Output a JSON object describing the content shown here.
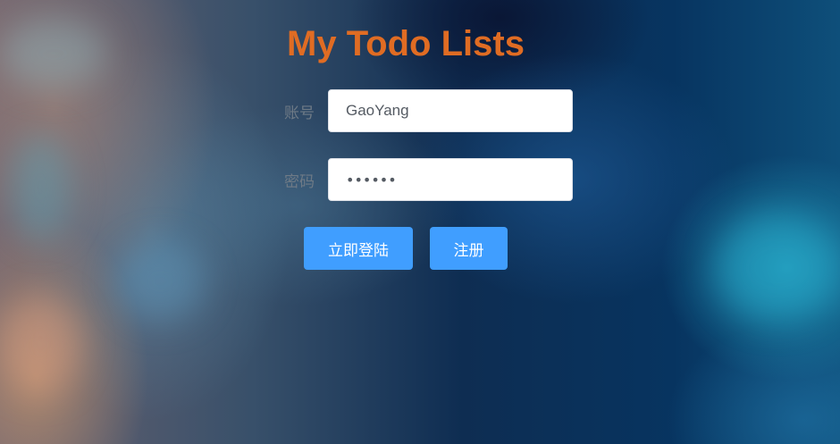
{
  "page": {
    "title": "My Todo Lists",
    "accent_color": "#e06c23",
    "button_color": "#409eff"
  },
  "form": {
    "account": {
      "label": "账号",
      "value": "GaoYang"
    },
    "password": {
      "label": "密码",
      "value": "••••••"
    }
  },
  "actions": {
    "login_label": "立即登陆",
    "register_label": "注册"
  }
}
